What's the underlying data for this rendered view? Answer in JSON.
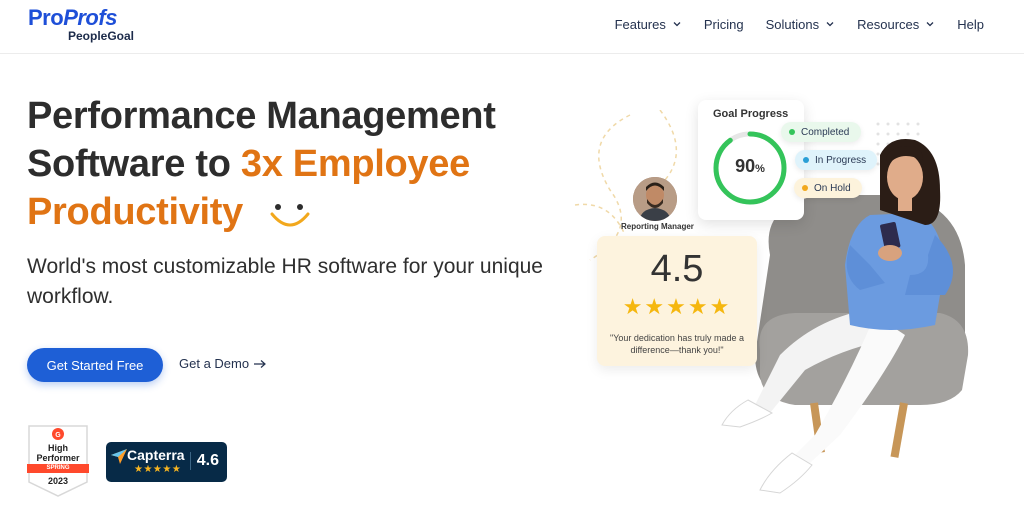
{
  "header": {
    "logo_main_a": "Pro",
    "logo_main_b": "Profs",
    "logo_sub": "PeopleGoal",
    "nav": [
      {
        "label": "Features",
        "has_dropdown": true
      },
      {
        "label": "Pricing",
        "has_dropdown": false
      },
      {
        "label": "Solutions",
        "has_dropdown": true
      },
      {
        "label": "Resources",
        "has_dropdown": true
      },
      {
        "label": "Help",
        "has_dropdown": false
      }
    ]
  },
  "hero": {
    "title_line1": "Performance Management",
    "title_line2_a": "Software to ",
    "title_line2_b": "3x Employee",
    "title_line3": "Productivity",
    "subtitle": "World's most customizable HR software for your unique workflow.",
    "cta_primary": "Get Started Free",
    "cta_secondary": "Get a Demo"
  },
  "badges": {
    "g2_top": "High",
    "g2_mid": "Performer",
    "g2_season": "SPRING",
    "g2_year": "2023",
    "capterra_name": "Capterra",
    "capterra_stars": "★★★★★",
    "capterra_score": "4.6"
  },
  "goal_card": {
    "title": "Goal Progress",
    "value": "90",
    "unit": "%",
    "progress_fraction": 0.9,
    "statuses": [
      {
        "label": "Completed",
        "color": "#34c45a"
      },
      {
        "label": "In Progress",
        "color": "#2a9fd6"
      },
      {
        "label": "On Hold",
        "color": "#f2a81d"
      }
    ]
  },
  "rating_card": {
    "manager_label": "Reporting Manager",
    "score": "4.5",
    "stars": "★★★★★",
    "quote": "\"Your dedication has truly made a difference—thank you!\""
  },
  "colors": {
    "brand_blue": "#1e5fd6",
    "accent_orange": "#e07414",
    "capterra_bg": "#072a47"
  }
}
